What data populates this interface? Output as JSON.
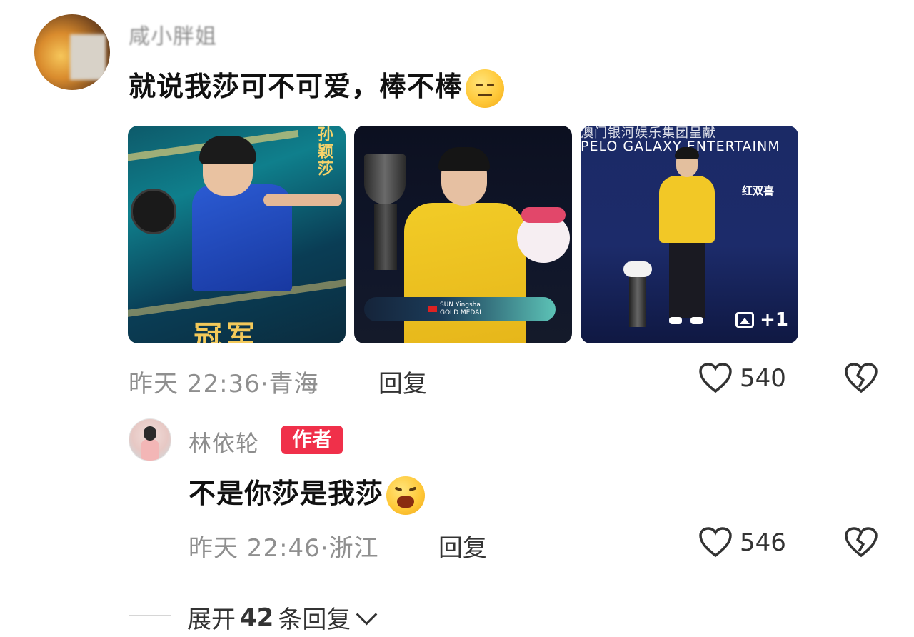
{
  "comments": [
    {
      "username": "咸小胖姐",
      "text": "就说我莎可不可爱，棒不棒",
      "emoji": "thinking-face-emoji",
      "images": [
        {
          "overlay_vertical": "孙颖莎",
          "overlay_bottom": "冠军"
        },
        {
          "lower_third_name": "SUN Yingsha",
          "lower_third_sub": "GOLD MEDAL"
        },
        {
          "banner_top": "澳门银河娱乐集团呈献",
          "banner": "PELO GALAXY ENTERTAINM",
          "sponsor_right": "红双喜",
          "more_count": "+1"
        }
      ],
      "time": "昨天 22:36",
      "location": "青海",
      "reply_label": "回复",
      "likes": "540"
    },
    {
      "username": "林依轮",
      "badge": "作者",
      "text": "不是你莎是我莎",
      "emoji": "crying-face-emoji",
      "time": "昨天 22:46",
      "location": "浙江",
      "reply_label": "回复",
      "likes": "546"
    }
  ],
  "expand": {
    "prefix": "展开",
    "count": "42",
    "suffix": "条回复"
  },
  "colors": {
    "badge": "#f0304a",
    "meta": "#8f8f8f"
  }
}
